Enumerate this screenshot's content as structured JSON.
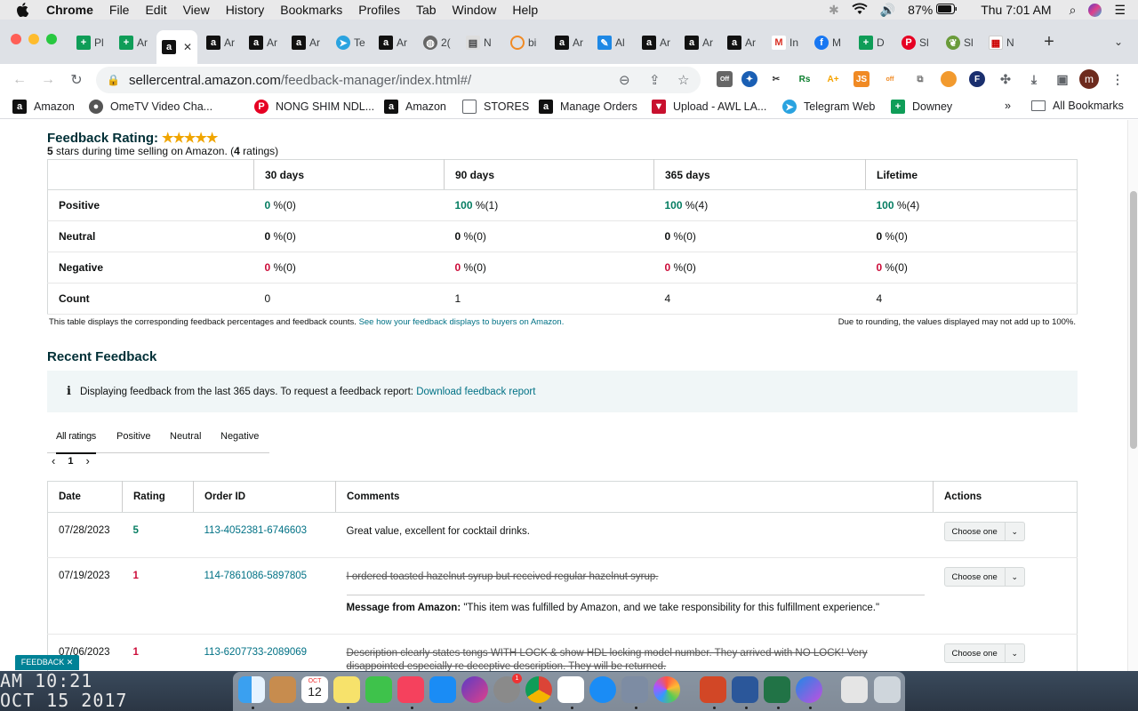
{
  "menubar": {
    "app": "Chrome",
    "items": [
      "File",
      "Edit",
      "View",
      "History",
      "Bookmarks",
      "Profiles",
      "Tab",
      "Window",
      "Help"
    ],
    "battery": "87%",
    "clock": "Thu 7:01 AM"
  },
  "tabs": [
    {
      "label": "Pl",
      "icon": "sheets-icon"
    },
    {
      "label": "Ar",
      "icon": "sheets-icon"
    },
    {
      "label": "",
      "icon": "amazon-icon",
      "active": true
    },
    {
      "label": "Ar",
      "icon": "amazon-icon"
    },
    {
      "label": "Ar",
      "icon": "amazon-icon"
    },
    {
      "label": "Ar",
      "icon": "amazon-icon"
    },
    {
      "label": "Te",
      "icon": "telegram-icon"
    },
    {
      "label": "Ar",
      "icon": "amazon-icon"
    },
    {
      "label": "2(",
      "icon": "globe-icon"
    },
    {
      "label": "N",
      "icon": "news-icon"
    },
    {
      "label": "bi",
      "icon": "loading-icon"
    },
    {
      "label": "Ar",
      "icon": "amazon-icon"
    },
    {
      "label": "Al",
      "icon": "pen-icon"
    },
    {
      "label": "Ar",
      "icon": "amazon-icon"
    },
    {
      "label": "Ar",
      "icon": "amazon-icon"
    },
    {
      "label": "Ar",
      "icon": "amazon-icon"
    },
    {
      "label": "In",
      "icon": "gmail-icon"
    },
    {
      "label": "M",
      "icon": "facebook-icon"
    },
    {
      "label": "D",
      "icon": "sheets-icon"
    },
    {
      "label": "Sl",
      "icon": "pinterest-icon"
    },
    {
      "label": "Sl",
      "icon": "plant-icon"
    },
    {
      "label": "N",
      "icon": "store-icon"
    }
  ],
  "address": {
    "host": "sellercentral.amazon.com",
    "path": "/feedback-manager/index.html#/"
  },
  "bookmarks": [
    {
      "label": "Amazon",
      "icon": "amazon-icon"
    },
    {
      "label": "OmeTV Video Cha...",
      "icon": "ometv-icon"
    },
    {
      "label": "NONG SHIM NDL...",
      "icon": "pinterest-icon"
    },
    {
      "label": "Amazon",
      "icon": "amazon-icon"
    },
    {
      "label": "STORES",
      "icon": "folder-icon"
    },
    {
      "label": "Manage Orders",
      "icon": "amazon-icon"
    },
    {
      "label": "Upload - AWL LA...",
      "icon": "awl-icon"
    },
    {
      "label": "Telegram Web",
      "icon": "telegram-icon"
    },
    {
      "label": "Downey",
      "icon": "sheets-icon"
    }
  ],
  "all_bookmarks": "All Bookmarks",
  "overflow": "»",
  "rating": {
    "title": "Feedback Rating:",
    "stars": "★★★★★",
    "subtitle_count": "5",
    "subtitle_mid": " stars during time selling on Amazon. (",
    "subtitle_ratings": "4",
    "subtitle_end": " ratings)"
  },
  "summary": {
    "headers": [
      "30 days",
      "90 days",
      "365 days",
      "Lifetime"
    ],
    "rows": [
      {
        "label": "Positive",
        "cells": [
          {
            "v": "0",
            "s": " %(0)"
          },
          {
            "v": "100",
            "s": " %(1)"
          },
          {
            "v": "100",
            "s": " %(4)"
          },
          {
            "v": "100",
            "s": " %(4)"
          }
        ]
      },
      {
        "label": "Neutral",
        "cells": [
          {
            "v": "0",
            "s": " %(0)"
          },
          {
            "v": "0",
            "s": " %(0)"
          },
          {
            "v": "0",
            "s": " %(0)"
          },
          {
            "v": "0",
            "s": " %(0)"
          }
        ]
      },
      {
        "label": "Negative",
        "cells": [
          {
            "v": "0",
            "s": " %(0)"
          },
          {
            "v": "0",
            "s": " %(0)"
          },
          {
            "v": "0",
            "s": " %(0)"
          },
          {
            "v": "0",
            "s": " %(0)"
          }
        ]
      },
      {
        "label": "Count",
        "cells": [
          {
            "v": "0",
            "s": ""
          },
          {
            "v": "1",
            "s": ""
          },
          {
            "v": "4",
            "s": ""
          },
          {
            "v": "4",
            "s": ""
          }
        ]
      }
    ],
    "note_left": "This table displays the corresponding feedback percentages and feedback counts. ",
    "note_link": "See how your feedback displays to buyers on Amazon.",
    "note_right": "Due to rounding, the values displayed may not add up to 100%."
  },
  "recent": {
    "title": "Recent Feedback",
    "info_text": "Displaying feedback from the last 365 days. To request a feedback report: ",
    "info_link": "Download feedback report",
    "filters": [
      "All ratings",
      "Positive",
      "Neutral",
      "Negative"
    ],
    "page": "1",
    "columns": [
      "Date",
      "Rating",
      "Order ID",
      "Comments",
      "Actions"
    ],
    "rows": [
      {
        "date": "07/28/2023",
        "rating": "5",
        "order": "113-4052381-6746603",
        "comment": "Great value, excellent for cocktail drinks.",
        "struck": false,
        "message_label": "",
        "message": "",
        "action": "Choose one"
      },
      {
        "date": "07/19/2023",
        "rating": "1",
        "order": "114-7861086-5897805",
        "comment": "I ordered toasted hazelnut syrup but received regular hazelnut syrup.",
        "struck": true,
        "message_label": "Message from Amazon:",
        "message": " \"This item was fulfilled by Amazon, and we take responsibility for this fulfillment experience.\"",
        "action": "Choose one"
      },
      {
        "date": "07/06/2023",
        "rating": "1",
        "order": "113-6207733-2089069",
        "comment": "Description clearly states tongs WITH LOCK & show HDL locking model number. They arrived with NO LOCK! Very disappointed especially re deceptive description. They will be returned.",
        "struck": true,
        "message_label": "",
        "message": "",
        "action": "Choose one"
      }
    ]
  },
  "feedback_pill": "FEEDBACK ✕",
  "desktop": {
    "line1": "AM 10:21",
    "line2": "OCT 15 2017"
  },
  "dock": {
    "calendar_month": "OCT",
    "calendar_day": "12",
    "badge": "1"
  },
  "colors": {
    "positive": "#067d62",
    "negative": "#cc0c39",
    "link": "#007185",
    "heading": "#002f36"
  }
}
